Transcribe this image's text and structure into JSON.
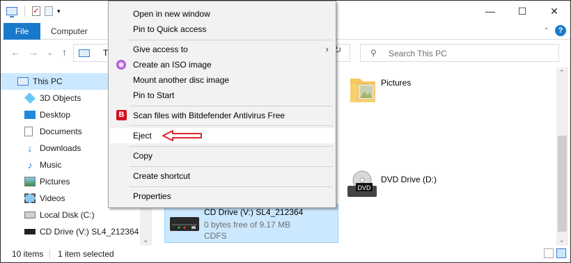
{
  "window": {
    "controls": {
      "minimize": "—",
      "maximize": "☐",
      "close": "✕"
    }
  },
  "ribbon": {
    "tabs": [
      {
        "label": "File"
      },
      {
        "label": "Computer"
      }
    ],
    "help": "?",
    "collapse": "⌃"
  },
  "address": {
    "path_fragment": "Th",
    "search_placeholder": "Search This PC",
    "back": "←",
    "forward": "→",
    "recent": "⌄",
    "up": "↑",
    "refresh": "↻"
  },
  "navigation": {
    "items": [
      {
        "label": "This PC",
        "icon": "computer-icon",
        "selected": true
      },
      {
        "label": "3D Objects",
        "icon": "cube-icon"
      },
      {
        "label": "Desktop",
        "icon": "desktop-icon"
      },
      {
        "label": "Documents",
        "icon": "documents-icon"
      },
      {
        "label": "Downloads",
        "icon": "download-icon"
      },
      {
        "label": "Music",
        "icon": "music-icon"
      },
      {
        "label": "Pictures",
        "icon": "pictures-icon"
      },
      {
        "label": "Videos",
        "icon": "videos-icon"
      },
      {
        "label": "Local Disk (C:)",
        "icon": "disk-icon"
      },
      {
        "label": "CD Drive (V:) SL4_212364",
        "icon": "cd-drive-icon"
      }
    ]
  },
  "content": {
    "pictures_folder": "Pictures",
    "dvd_drive": "DVD Drive (D:)",
    "dvd_badge": "DVD",
    "cd_drive": {
      "name": "CD Drive (V:) SL4_212364",
      "free": "0 bytes free of 9.17 MB",
      "filesystem": "CDFS"
    }
  },
  "context_menu": {
    "items": [
      {
        "label": "Open in new window"
      },
      {
        "label": "Pin to Quick access"
      },
      {
        "label": "Give access to",
        "submenu": true
      },
      {
        "label": "Create an ISO image",
        "icon": "iso-icon"
      },
      {
        "label": "Mount another disc image"
      },
      {
        "label": "Pin to Start"
      },
      {
        "label": "Scan files with Bitdefender Antivirus Free",
        "icon": "bitdefender-icon"
      },
      {
        "label": "Eject",
        "highlighted": true
      },
      {
        "label": "Copy"
      },
      {
        "label": "Create shortcut"
      },
      {
        "label": "Properties"
      }
    ],
    "bitdefender_letter": "B",
    "submenu_arrow": "›"
  },
  "status": {
    "item_count": "10 items",
    "selection": "1 item selected"
  },
  "colors": {
    "accent": "#1979ca",
    "selection": "#cce8ff",
    "annotation_arrow": "#d9262c"
  }
}
